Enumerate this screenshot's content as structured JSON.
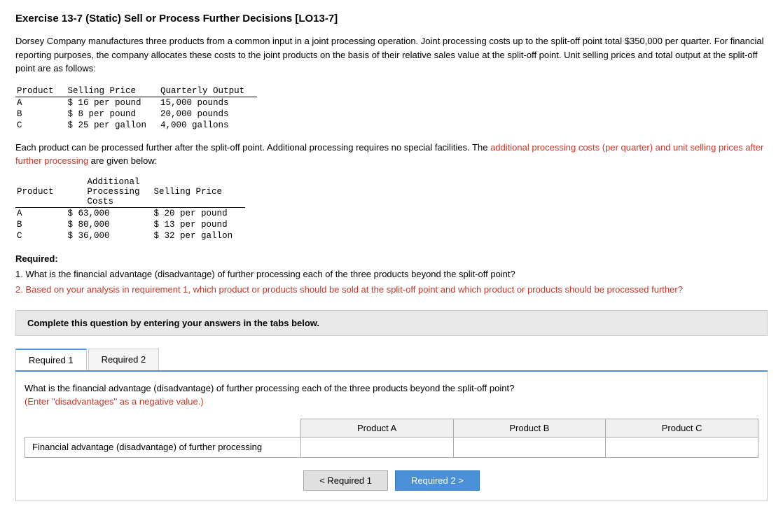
{
  "title": "Exercise 13-7 (Static) Sell or Process Further Decisions [LO13-7]",
  "description": {
    "text1": "Dorsey Company manufactures three products from a common input in a joint processing operation. Joint processing costs up to the split-off point total $350,000 per quarter. For financial reporting purposes, the company allocates these costs to the joint products on the basis of their relative sales value at the split-off point. Unit selling prices and total output at the split-off point are as follows:"
  },
  "table1": {
    "headers": [
      "Product",
      "Selling Price",
      "Quarterly Output"
    ],
    "rows": [
      [
        "A",
        "$ 16  per pound",
        "15,000  pounds"
      ],
      [
        "B",
        "$ 8  per pound",
        "20,000  pounds"
      ],
      [
        "C",
        "$ 25  per gallon",
        "4,000  gallons"
      ]
    ]
  },
  "para2": {
    "text": "Each product can be processed further after the split-off point. Additional processing requires no special facilities. The additional processing costs (per quarter) and unit selling prices after further processing are given below:"
  },
  "table2": {
    "headers": [
      "Product",
      "Additional Processing Costs",
      "Selling Price"
    ],
    "rows": [
      [
        "A",
        "$ 63,000",
        "$ 20  per pound"
      ],
      [
        "B",
        "$ 80,000",
        "$ 13  per pound"
      ],
      [
        "C",
        "$ 36,000",
        "$ 32  per gallon"
      ]
    ]
  },
  "required_label": "Required:",
  "required_items": [
    "1. What is the financial advantage (disadvantage) of further processing each of the three products beyond the split-off point?",
    "2. Based on your analysis in requirement 1, which product or products should be sold at the split-off point and which product or products should be processed further?"
  ],
  "complete_box": "Complete this question by entering your answers in the tabs below.",
  "tabs": [
    {
      "label": "Required 1",
      "active": true
    },
    {
      "label": "Required 2",
      "active": false
    }
  ],
  "tab1": {
    "question_line1": "What is the financial advantage (disadvantage) of further processing each of the three products beyond the split-off point?",
    "question_line2": "(Enter \"disadvantages\" as a negative value.)",
    "table_headers": [
      "",
      "Product A",
      "Product B",
      "Product C"
    ],
    "row_label": "Financial advantage (disadvantage) of further processing",
    "inputs": [
      "",
      "",
      ""
    ]
  },
  "nav_buttons": [
    {
      "label": "< Required 1",
      "active": false
    },
    {
      "label": "Required 2 >",
      "active": true
    }
  ]
}
